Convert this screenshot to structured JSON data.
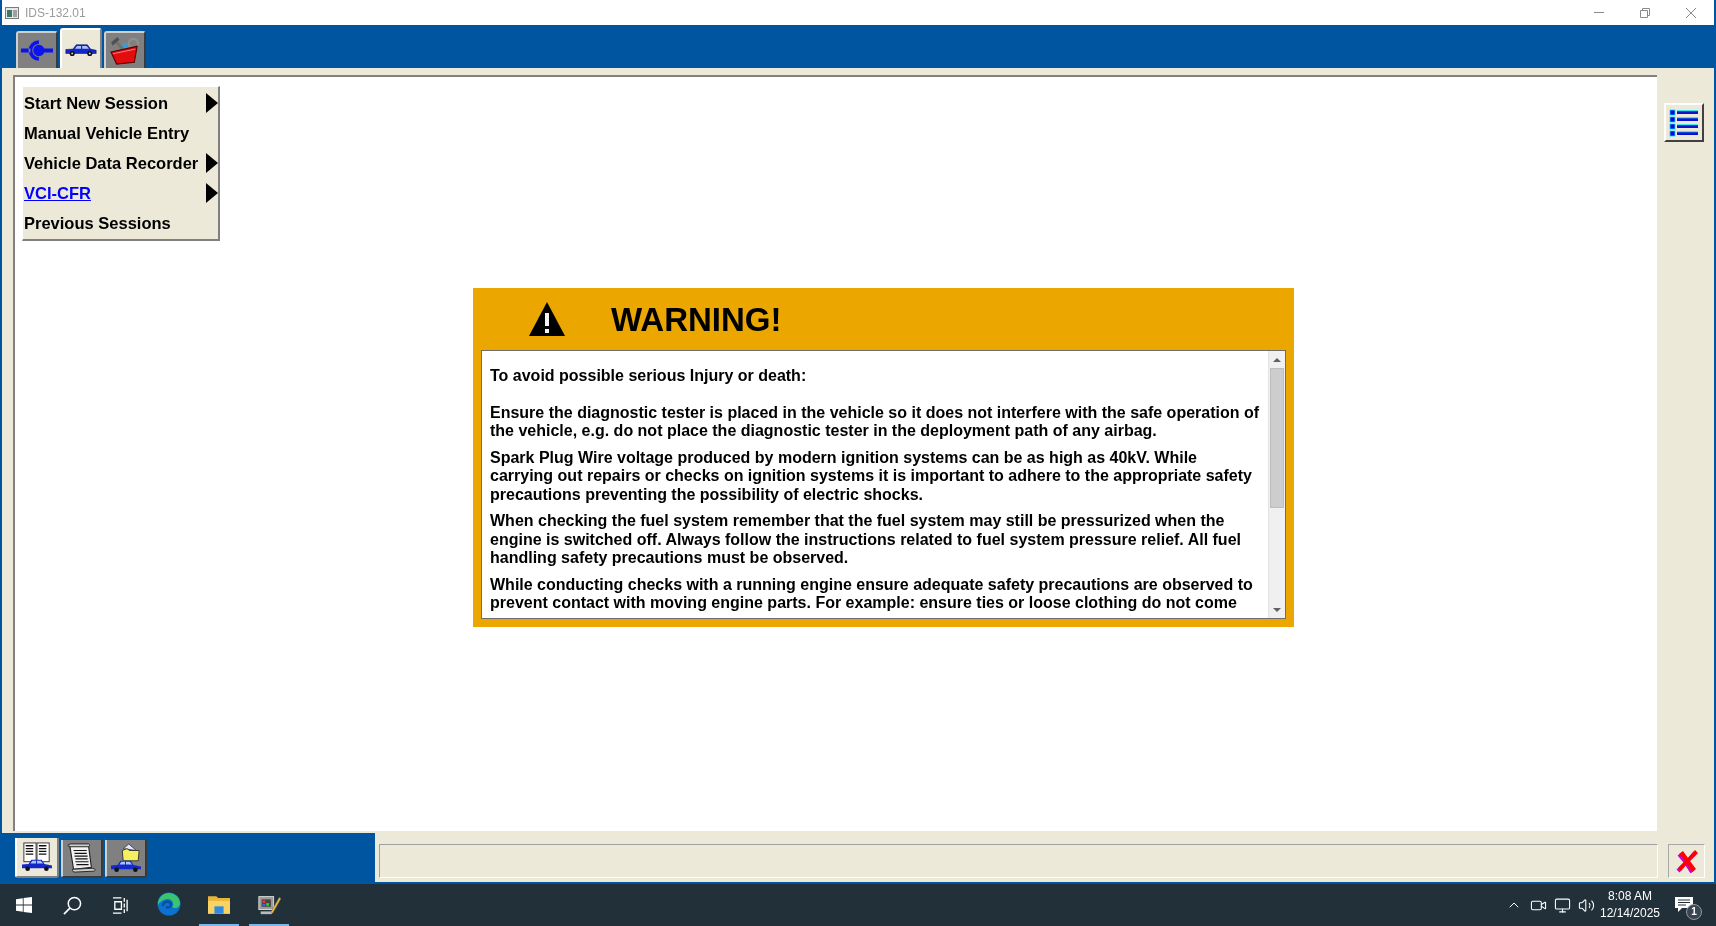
{
  "window": {
    "title": "IDS-132.01"
  },
  "toolbar_tabs": [
    {
      "kind": "connector",
      "selected": false
    },
    {
      "kind": "vehicle",
      "selected": true
    },
    {
      "kind": "toolbox",
      "selected": false
    }
  ],
  "menu": {
    "items": [
      {
        "label": "Start New Session",
        "has_submenu": true,
        "hovered": false
      },
      {
        "label": "Manual Vehicle Entry",
        "has_submenu": false,
        "hovered": false
      },
      {
        "label": "Vehicle Data Recorder",
        "has_submenu": true,
        "hovered": false
      },
      {
        "label": "VCI-CFR",
        "has_submenu": true,
        "hovered": true
      },
      {
        "label": "Previous Sessions",
        "has_submenu": false,
        "hovered": false
      }
    ]
  },
  "warning": {
    "title": "WARNING!",
    "intro": "To avoid possible serious Injury or death:",
    "paragraphs": [
      "Ensure the diagnostic tester is placed in the vehicle so it does not interfere with the safe operation of the vehicle, e.g. do not place the diagnostic tester in the deployment path of any airbag.",
      "Spark Plug Wire voltage produced by modern ignition systems can be as high as 40kV. While carrying out repairs or checks on ignition systems it is important to adhere to the appropriate safety precautions preventing the possibility of electric shocks.",
      "When checking the fuel system remember that the fuel system may still be pressurized when the engine is switched off. Always follow the instructions related to fuel system pressure relief. All fuel handling safety precautions must be observed.",
      "While conducting checks with a running engine ensure adequate safety precautions are observed to prevent contact with moving engine parts. For example: ensure ties or loose clothing do not come"
    ]
  },
  "bottom_tabs": [
    {
      "kind": "vehicle-records",
      "selected": true
    },
    {
      "kind": "scroll",
      "selected": false
    },
    {
      "kind": "vehicle-folder",
      "selected": false
    }
  ],
  "taskbar": {
    "buttons": [
      {
        "kind": "start"
      },
      {
        "kind": "search"
      },
      {
        "kind": "task-view"
      }
    ],
    "apps": [
      {
        "kind": "browser",
        "running": false
      },
      {
        "kind": "explorer",
        "running": true
      },
      {
        "kind": "diagnostic",
        "running": true
      }
    ],
    "tray": {
      "time": "8:08 AM",
      "date": "12/14/2025",
      "notification_count": "1"
    }
  }
}
